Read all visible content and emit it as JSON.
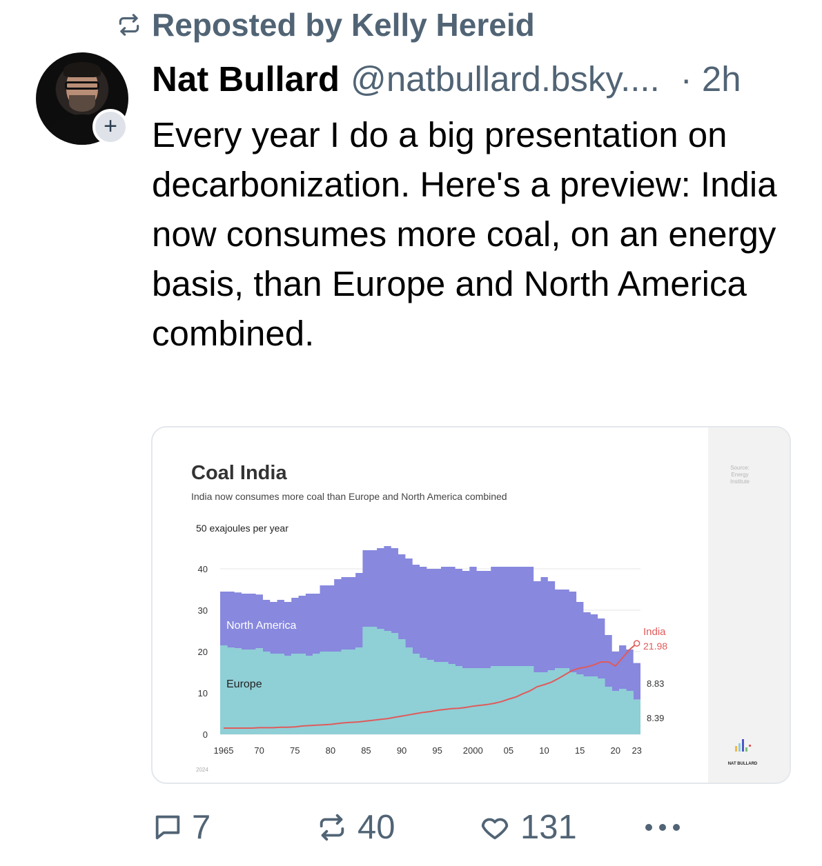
{
  "repost": {
    "label": "Reposted by Kelly Hereid"
  },
  "post": {
    "author_name": "Nat Bullard",
    "author_handle": "@natbullard.bsky....",
    "time": "· 2h",
    "text": "Every year I do a big presentation on decarbonization. Here's a preview: India now consumes more coal, on an energy basis, than Europe and North America combined."
  },
  "colors": {
    "accent_grey": "#516475",
    "north_america": "#8788de",
    "europe": "#8fcfd6",
    "india": "#e05a5a"
  },
  "icons": [
    "repost-icon",
    "plus-icon",
    "reply-icon",
    "repost-icon",
    "heart-icon",
    "more-icon"
  ],
  "card": {
    "source": "Source: Energy Institute",
    "brand": "NAT BULLARD",
    "year": "2024"
  },
  "chart_data": {
    "type": "area",
    "title": "Coal India",
    "subtitle": "India now consumes more coal than Europe and North America combined",
    "ylabel": "50 exajoules per year",
    "ylim": [
      0,
      50
    ],
    "yticks": [
      "0",
      "10",
      "20",
      "30",
      "40"
    ],
    "xticks": [
      "1965",
      "70",
      "75",
      "80",
      "85",
      "90",
      "95",
      "2000",
      "05",
      "10",
      "15",
      "20",
      "23"
    ],
    "x": [
      1965,
      1966,
      1967,
      1968,
      1969,
      1970,
      1971,
      1972,
      1973,
      1974,
      1975,
      1976,
      1977,
      1978,
      1979,
      1980,
      1981,
      1982,
      1983,
      1984,
      1985,
      1986,
      1987,
      1988,
      1989,
      1990,
      1991,
      1992,
      1993,
      1994,
      1995,
      1996,
      1997,
      1998,
      1999,
      2000,
      2001,
      2002,
      2003,
      2004,
      2005,
      2006,
      2007,
      2008,
      2009,
      2010,
      2011,
      2012,
      2013,
      2014,
      2015,
      2016,
      2017,
      2018,
      2019,
      2020,
      2021,
      2022,
      2023
    ],
    "series": [
      {
        "name": "Europe",
        "values": [
          21.5,
          21.0,
          20.8,
          20.5,
          20.5,
          20.8,
          20.0,
          19.5,
          19.5,
          19.0,
          19.5,
          19.5,
          19.0,
          19.5,
          20.0,
          20.0,
          20.0,
          20.5,
          20.5,
          21.0,
          26.0,
          26.0,
          25.5,
          25.0,
          24.5,
          23.0,
          21.0,
          19.5,
          18.5,
          18.0,
          17.5,
          17.5,
          17.0,
          16.5,
          16.0,
          16.0,
          16.0,
          16.0,
          16.5,
          16.5,
          16.5,
          16.5,
          16.5,
          16.5,
          15.0,
          15.0,
          15.5,
          16.0,
          16.0,
          15.0,
          14.5,
          14.0,
          14.0,
          13.5,
          11.5,
          10.5,
          11.0,
          10.5,
          8.39
        ]
      },
      {
        "name": "North America",
        "values": [
          13.0,
          13.5,
          13.5,
          13.5,
          13.5,
          13.0,
          12.5,
          12.5,
          13.0,
          13.0,
          13.5,
          14.0,
          15.0,
          14.5,
          16.0,
          16.0,
          17.5,
          17.5,
          17.5,
          18.0,
          18.5,
          18.5,
          19.5,
          20.5,
          20.5,
          20.5,
          21.5,
          21.5,
          22.0,
          22.0,
          22.5,
          23.0,
          23.5,
          23.5,
          23.5,
          24.5,
          23.5,
          23.5,
          24.0,
          24.0,
          24.0,
          24.0,
          24.0,
          24.0,
          22.0,
          23.0,
          21.5,
          19.0,
          19.0,
          19.5,
          17.5,
          15.5,
          15.0,
          14.5,
          12.5,
          9.5,
          10.5,
          10.0,
          8.83
        ]
      },
      {
        "name": "India",
        "values": [
          1.5,
          1.5,
          1.5,
          1.5,
          1.5,
          1.6,
          1.6,
          1.6,
          1.7,
          1.7,
          1.8,
          2.0,
          2.1,
          2.2,
          2.3,
          2.4,
          2.6,
          2.8,
          2.9,
          3.0,
          3.2,
          3.4,
          3.6,
          3.8,
          4.1,
          4.4,
          4.7,
          5.0,
          5.3,
          5.5,
          5.8,
          6.0,
          6.2,
          6.3,
          6.5,
          6.8,
          7.0,
          7.2,
          7.5,
          7.9,
          8.5,
          9.0,
          9.8,
          10.5,
          11.5,
          12.0,
          12.6,
          13.5,
          14.5,
          15.5,
          16.0,
          16.3,
          16.8,
          17.5,
          17.5,
          16.5,
          18.5,
          20.5,
          21.98
        ]
      }
    ],
    "annotations": [
      "India",
      "21.98",
      "8.83",
      "8.39"
    ]
  },
  "actions": {
    "replies": "7",
    "reposts": "40",
    "likes": "131"
  }
}
